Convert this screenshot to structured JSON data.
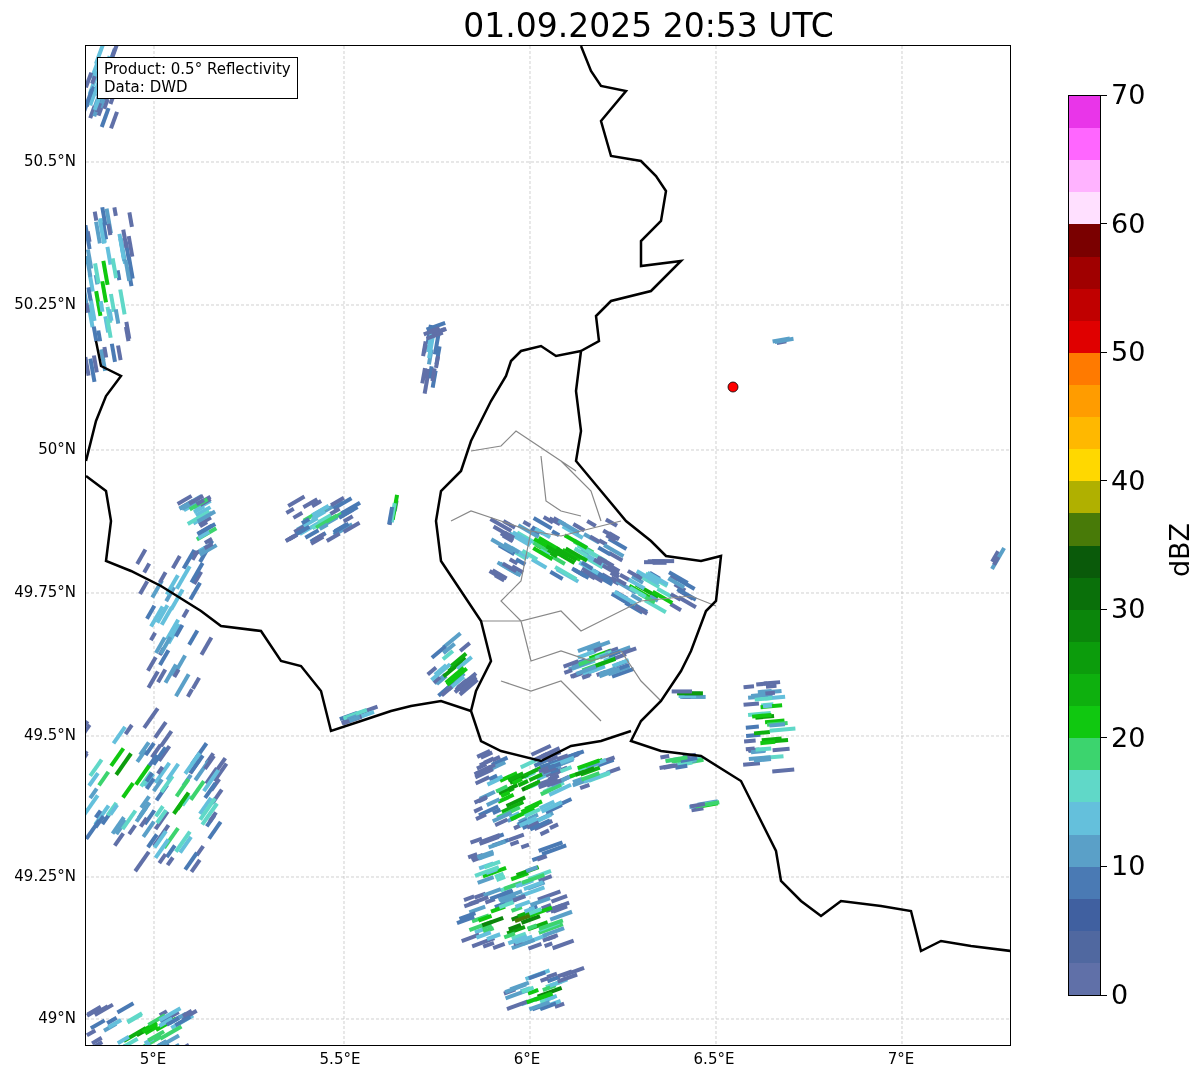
{
  "title": "01.09.2025 20:53 UTC",
  "info_box": [
    "Product: 0.5° Reflectivity",
    "Data: DWD"
  ],
  "x_ticks": [
    "5°E",
    "5.5°E",
    "6°E",
    "6.5°E",
    "7°E"
  ],
  "y_ticks": [
    "50.5°N",
    "50.25°N",
    "50°N",
    "49.75°N",
    "49.5°N",
    "49.25°N",
    "49°N"
  ],
  "colorbar": {
    "label": "dBZ",
    "ticks": [
      "70",
      "60",
      "50",
      "40",
      "30",
      "20",
      "10",
      "0"
    ],
    "segments": [
      {
        "color": "#e935e9"
      },
      {
        "color": "#ff66ff"
      },
      {
        "color": "#ffb3ff"
      },
      {
        "color": "#ffe0ff"
      },
      {
        "color": "#7a0000"
      },
      {
        "color": "#a00000"
      },
      {
        "color": "#c00000"
      },
      {
        "color": "#e00000"
      },
      {
        "color": "#ff7a00"
      },
      {
        "color": "#ff9c00"
      },
      {
        "color": "#ffb800"
      },
      {
        "color": "#ffd800"
      },
      {
        "color": "#b0b000"
      },
      {
        "color": "#487a08"
      },
      {
        "color": "#0a5a0a"
      },
      {
        "color": "#0a700a"
      },
      {
        "color": "#0b860b"
      },
      {
        "color": "#0c9c0c"
      },
      {
        "color": "#0eb00e"
      },
      {
        "color": "#10c810"
      },
      {
        "color": "#3cd46e"
      },
      {
        "color": "#60d8c8"
      },
      {
        "color": "#64c0dc"
      },
      {
        "color": "#5aa0c8"
      },
      {
        "color": "#4a7ab4"
      },
      {
        "color": "#4060a0"
      },
      {
        "color": "#5068a0"
      },
      {
        "color": "#6070a8"
      }
    ]
  }
}
